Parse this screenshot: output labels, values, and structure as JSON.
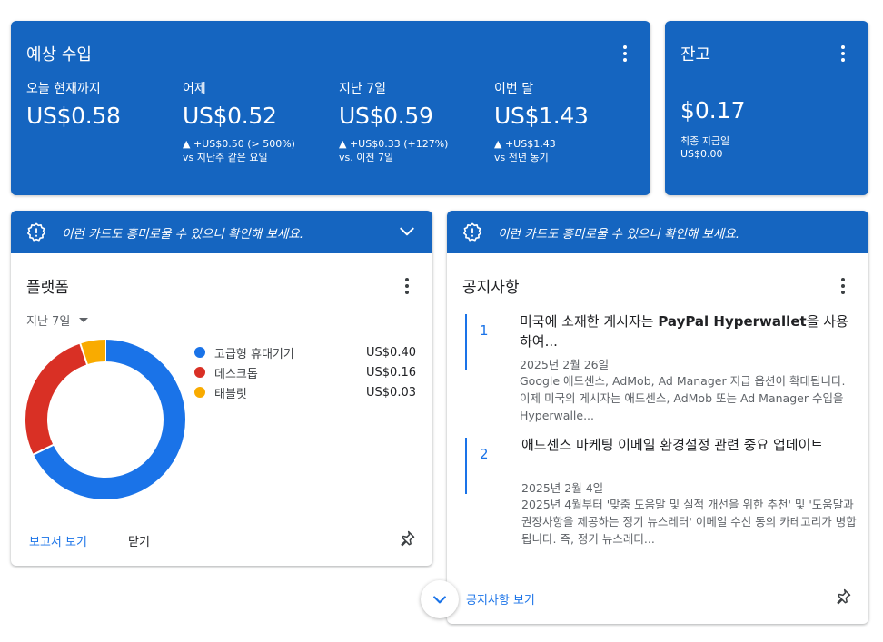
{
  "earnings": {
    "title": "예상 수입",
    "metrics": [
      {
        "label": "오늘 현재까지",
        "value": "US$0.58",
        "delta": "",
        "sub": ""
      },
      {
        "label": "어제",
        "value": "US$0.52",
        "delta": "▲ +US$0.50 (> 500%)",
        "sub": "vs 지난주 같은 요일"
      },
      {
        "label": "지난 7일",
        "value": "US$0.59",
        "delta": "▲ +US$0.33 (+127%)",
        "sub": "vs. 이전 7일"
      },
      {
        "label": "이번 달",
        "value": "US$1.43",
        "delta": "▲ +US$1.43",
        "sub": "vs 전년 동기"
      }
    ]
  },
  "balance": {
    "title": "잔고",
    "value": "$0.17",
    "last_payment_label": "최종 지급일",
    "last_payment_amount": "US$0.00"
  },
  "banner": {
    "text": "이런 카드도 흥미로울 수 있으니 확인해 보세요."
  },
  "platform": {
    "title": "플랫폼",
    "range": "지난 7일",
    "report_link": "보고서 보기",
    "close_label": "닫기"
  },
  "chart_data": {
    "type": "pie",
    "categories": [
      "고급형 휴대기기",
      "데스크톱",
      "태블릿"
    ],
    "values": [
      0.4,
      0.16,
      0.03
    ],
    "labels": [
      "US$0.40",
      "US$0.16",
      "US$0.03"
    ],
    "colors": [
      "#1a73e8",
      "#d93025",
      "#f9ab00"
    ],
    "legend": "right"
  },
  "notices": {
    "title": "공지사항",
    "items": [
      {
        "num": "1",
        "title_pre": "미국에 소재한 게시자는 ",
        "title_bold": "PayPal Hyperwallet",
        "title_post": "을 사용하여...",
        "date": "2025년 2월 26일",
        "body": "Google 애드센스, AdMob, Ad Manager 지급 옵션이 확대됩니다. 이제 미국의 게시자는 애드센스, AdMob 또는 Ad Manager 수입을 Hyperwalle..."
      },
      {
        "num": "2",
        "title_pre": "애드센스 마케팅 이메일 환경설정 관련 중요 업데이트",
        "title_bold": "",
        "title_post": "",
        "date": "2025년 2월 4일",
        "body": "2025년 4월부터 '맞춤 도움말 및 실적 개선을 위한 추천' 및 '도움말과 권장사항을 제공하는 정기 뉴스레터' 이메일 수신 동의 카테고리가 병합됩니다. 즉, 정기 뉴스레터..."
      }
    ],
    "view_link": "공지사항 보기"
  },
  "icons": {
    "tip": "lightbulb-badge-icon",
    "expand": "chevron-down-icon",
    "pin": "pin-icon",
    "menu": "more-vert-icon"
  }
}
